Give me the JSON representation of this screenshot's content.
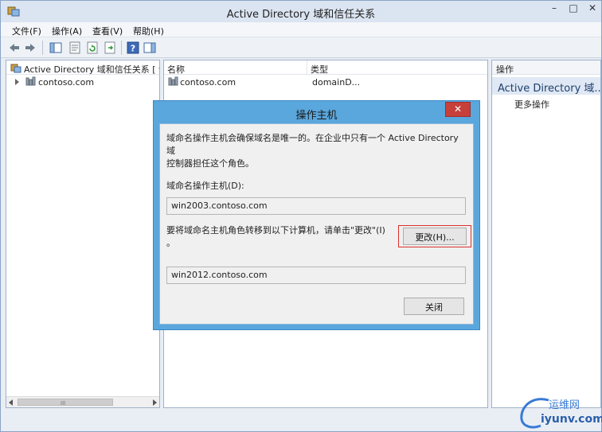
{
  "window": {
    "title": "Active Directory 域和信任关系",
    "minimize": "–",
    "maximize": "□",
    "close": "✕"
  },
  "menu": {
    "file": "文件(F)",
    "action": "操作(A)",
    "view": "查看(V)",
    "help": "帮助(H)"
  },
  "toolbar": {
    "icons": [
      "back-icon",
      "forward-icon",
      "show-tree-icon",
      "properties-icon",
      "refresh-icon",
      "export-icon",
      "help-icon",
      "console-tree-icon"
    ]
  },
  "tree": {
    "root_label": "Active Directory 域和信任关系 [ w",
    "child_label": "contoso.com",
    "scroll_grip": "III"
  },
  "list": {
    "col_name": "名称",
    "col_type": "类型",
    "rows": [
      {
        "name": "contoso.com",
        "type": "domainD..."
      }
    ]
  },
  "actions": {
    "title": "操作",
    "section": "Active Directory 域...",
    "more": "更多操作"
  },
  "dialog": {
    "title": "操作主机",
    "close": "✕",
    "description_line1": "域命名操作主机会确保域名是唯一的。在企业中只有一个 Active Directory 域",
    "description_line2": "控制器担任这个角色。",
    "current_label": "域命名操作主机(D):",
    "current_value": "win2003.contoso.com",
    "transfer_line1": "要将域命名主机角色转移到以下计算机，请单击\"更改\"(I)",
    "transfer_line2": "。",
    "change_button": "更改(H)...",
    "target_value": "win2012.contoso.com",
    "close_button": "关闭"
  },
  "watermark": {
    "cn": "运维网",
    "url": "iyunv.com"
  },
  "colors": {
    "dialog_frame": "#5aa7dd",
    "close_red": "#c8403a",
    "highlight": "#d9302b"
  }
}
